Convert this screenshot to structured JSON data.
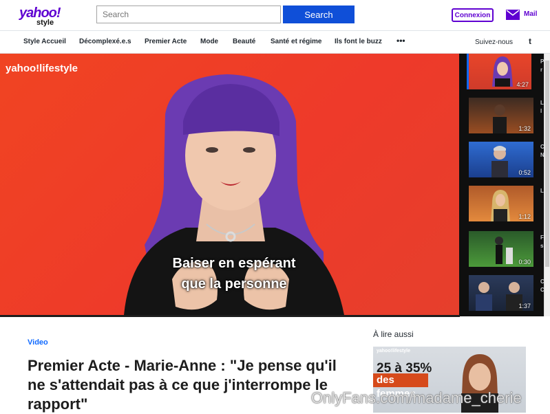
{
  "header": {
    "logo_main": "yahoo!",
    "logo_sub": "style",
    "search_placeholder": "Search",
    "search_button": "Search",
    "signin": "Connexion",
    "mail": "Mail"
  },
  "nav": {
    "items": [
      "Style Accueil",
      "Décomplexé.e.s",
      "Premier Acte",
      "Mode",
      "Beauté",
      "Santé et régime",
      "Ils font le buzz"
    ],
    "more": "•••",
    "follow": "Suivez-nous",
    "social": "t"
  },
  "player": {
    "brand": "yahoo!lifestyle",
    "subtitle_line1": "Baiser en espérant",
    "subtitle_line2": "que la personne"
  },
  "playlist": {
    "items": [
      {
        "duration": "4:27",
        "title_fragment": "P A r"
      },
      {
        "duration": "1:32",
        "title_fragment": "L N l"
      },
      {
        "duration": "0:52",
        "title_fragment": "C N N"
      },
      {
        "duration": "1:12",
        "title_fragment": "L C"
      },
      {
        "duration": "0:30",
        "title_fragment": "F K s"
      },
      {
        "duration": "1:37",
        "title_fragment": "C L C"
      }
    ]
  },
  "article": {
    "category": "Video",
    "headline": "Premier Acte - Marie-Anne : \"Je pense qu'il ne s'attendait pas à ce que j'interrompe le rapport\""
  },
  "aside": {
    "title": "À lire aussi",
    "card_brand": "yahoo!lifestyle",
    "card_big": "25 à 35%",
    "card_accent": "des femmes"
  },
  "watermark": "OnlyFans.com/madame_cherie",
  "colors": {
    "brand_purple": "#5f01d1",
    "search_blue": "#0f4fd8",
    "link_blue": "#0f69ff",
    "player_red": "#f04422",
    "hair_purple": "#6b3bb2"
  }
}
